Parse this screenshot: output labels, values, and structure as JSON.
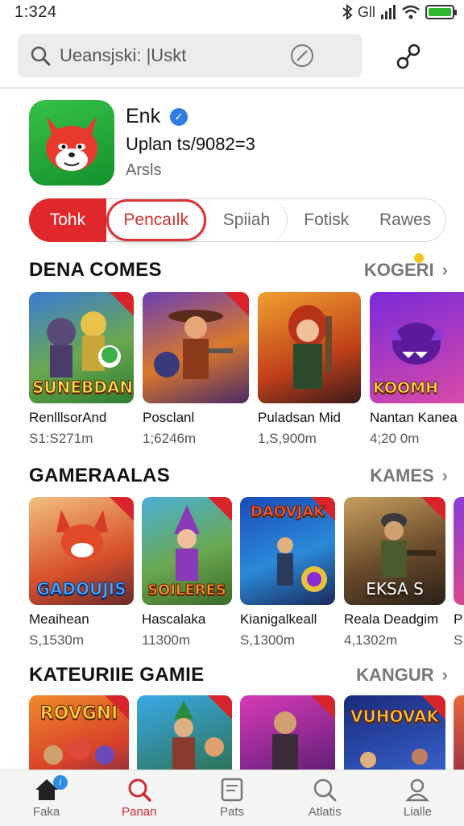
{
  "status_bar": {
    "time": "1:324",
    "signal_text": "Gll"
  },
  "search": {
    "value": "Ueansjski: |Uskt"
  },
  "app": {
    "name": "Enk",
    "subtitle": "Uplan ts/9082=3",
    "category": "Arsls"
  },
  "tabs": [
    {
      "label": "Tohk",
      "active": true
    },
    {
      "label": "Pencaılk",
      "selected": true
    },
    {
      "label": "Spiiah"
    },
    {
      "label": "Fotisk"
    },
    {
      "label": "Rawes"
    }
  ],
  "sections": [
    {
      "title": "DENA COMES",
      "link": "KOGERI",
      "items": [
        {
          "name": "RenlllsorAnd",
          "meta": "S1:S271m",
          "art": "SUNEBDAN"
        },
        {
          "name": "Posclanl",
          "meta": "1;6246m",
          "art": ""
        },
        {
          "name": "Puladsan Mid",
          "meta": "1,S,900m",
          "art": ""
        },
        {
          "name": "Nantan Kanea",
          "meta": "4;20 0m",
          "art": "KOOMH"
        }
      ]
    },
    {
      "title": "GAMERAALAS",
      "link": "KAMES",
      "items": [
        {
          "name": "Meaihean",
          "meta": "S,1530m",
          "art": "GADOUJIS"
        },
        {
          "name": "Hascalaka",
          "meta": "11300m",
          "art": "SOILERES"
        },
        {
          "name": "Kianigalkeall",
          "meta": "S,1300m",
          "art": "DAOVJAK"
        },
        {
          "name": "Reala Deadgim",
          "meta": "4,1302m",
          "art": "EKSA S"
        },
        {
          "name": "P",
          "meta": "S",
          "art": ""
        }
      ]
    },
    {
      "title": "KATEURIIE GAMIE",
      "link": "KANGUR",
      "items": [
        {
          "name": "",
          "meta": "",
          "art": "ROVGNI"
        },
        {
          "name": "",
          "meta": "",
          "art": ""
        },
        {
          "name": "",
          "meta": "",
          "art": ""
        },
        {
          "name": "",
          "meta": "",
          "art": "VUHOVAK"
        }
      ]
    }
  ],
  "bottom_nav": [
    {
      "label": "Faka",
      "icon": "home-icon",
      "badge": "i"
    },
    {
      "label": "Panan",
      "icon": "search-icon",
      "active": true
    },
    {
      "label": "Pats",
      "icon": "document-icon"
    },
    {
      "label": "Atlatis",
      "icon": "search-icon"
    },
    {
      "label": "Lialle",
      "icon": "person-icon"
    }
  ],
  "colors": {
    "accent": "#e0282c",
    "link": "#777777",
    "verified": "#2f7de1",
    "badge": "#2f8de4"
  }
}
